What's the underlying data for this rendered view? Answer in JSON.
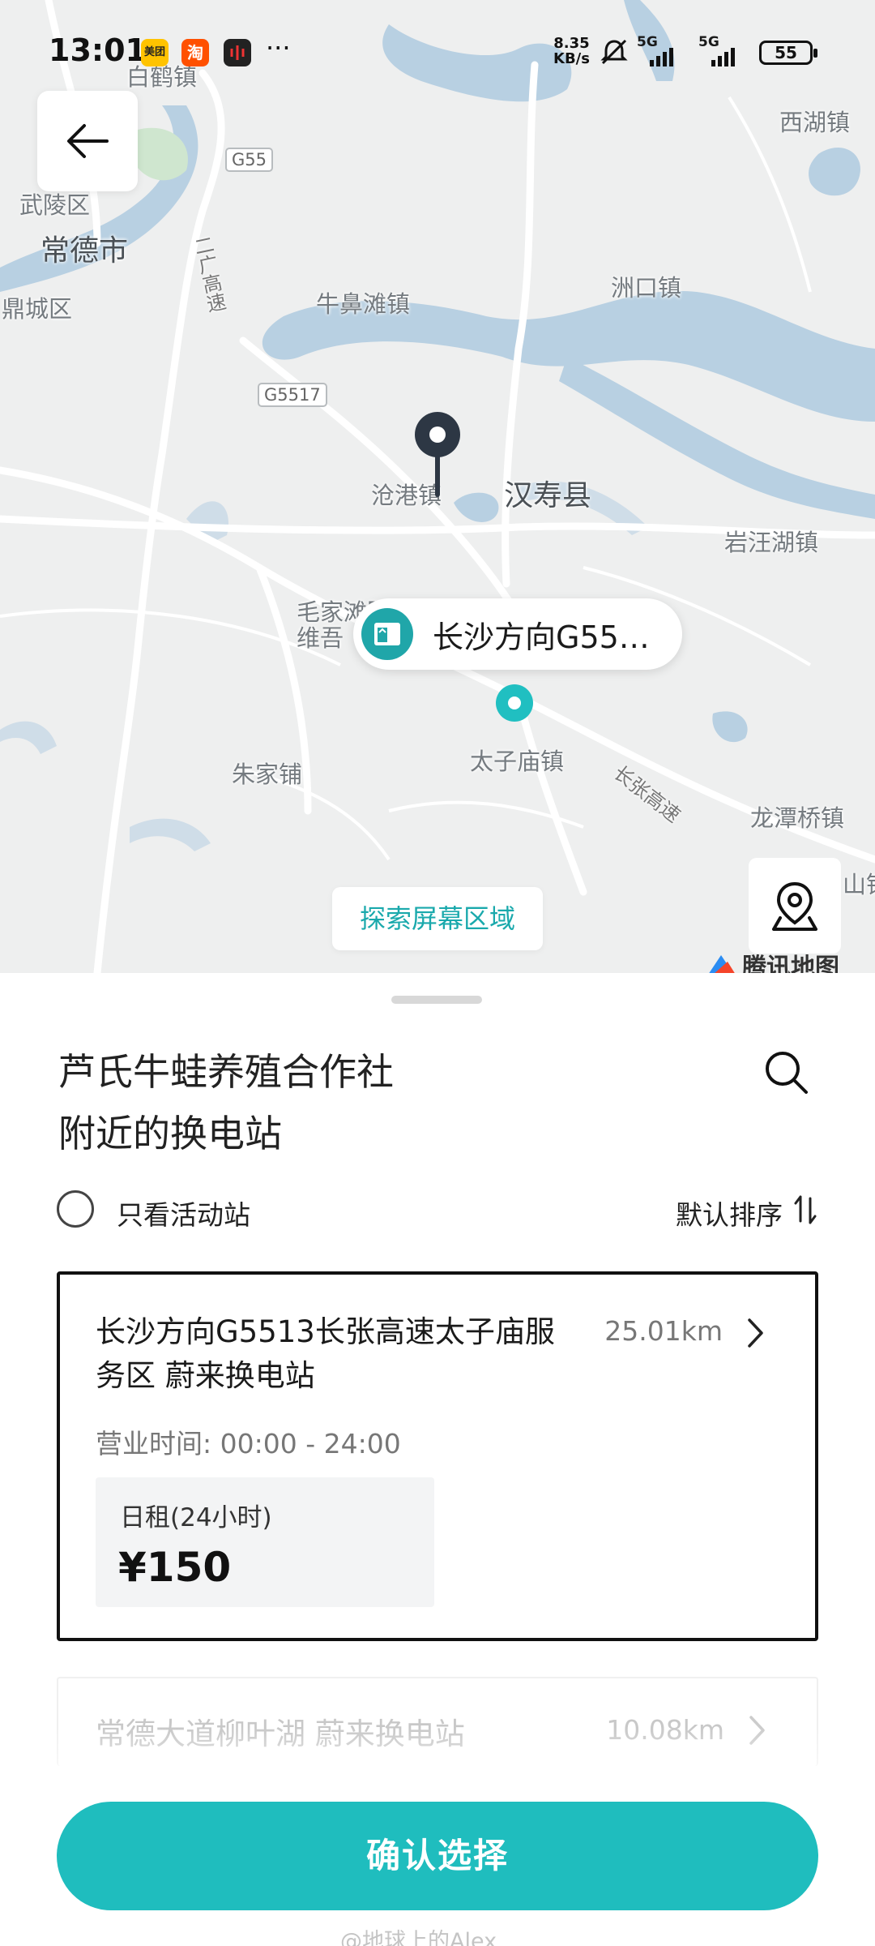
{
  "status_bar": {
    "time": "13:01",
    "app_icons": [
      {
        "name": "meituan-app-icon",
        "label": "美团",
        "color": "#ffc300"
      },
      {
        "name": "taobao-app-icon",
        "label": "淘",
        "color": "#ff5000"
      },
      {
        "name": "voice-app-icon",
        "label": "",
        "color": "#222222"
      }
    ],
    "more": "···",
    "net_speed_value": "8.35",
    "net_speed_unit": "KB/s",
    "signal_1_label": "5G",
    "signal_2_label": "5G",
    "battery": "55"
  },
  "map": {
    "places": {
      "baihe": "白鹤镇",
      "wuling": "武陵区",
      "changde": "常德市",
      "dingcheng": "鼎城区",
      "xihu": "西湖镇",
      "niubitan": "牛鼻滩镇",
      "zhoukou": "洲口镇",
      "canggang": "沧港镇",
      "hanshou": "汉寿县",
      "yanwanghu": "岩汪湖镇",
      "maojiatan": "毛家滩回族",
      "weiwu": "维吾",
      "zhujiapu": "朱家铺",
      "taizimiao": "太子庙镇",
      "longtanqiao": "龙潭桥镇",
      "shan_partial": "山镇"
    },
    "roads": {
      "g55": "G55",
      "g5517": "G5517",
      "erguang": "二广高速",
      "changzhang": "长张高速"
    },
    "callout_label": "长沙方向G55…",
    "explore_button": "探索屏幕区域",
    "logo_text": "腾讯地图",
    "colors": {
      "water": "#b8d0e2",
      "land": "#eeefef",
      "road": "#ffffff",
      "accent": "#1fbdbe"
    }
  },
  "sheet": {
    "title_line1": "芦氏牛蛙养殖合作社",
    "title_line2": "附近的换电站",
    "filter_label": "只看活动站",
    "sort_label": "默认排序",
    "stations": [
      {
        "name": "长沙方向G5513长张高速太子庙服务区 蔚来换电站",
        "distance": "25.01km",
        "hours": "营业时间: 00:00 - 24:00",
        "price_label": "日租(24小时)",
        "price": "¥150"
      },
      {
        "name": "常德大道柳叶湖 蔚来换电站",
        "distance": "10.08km"
      }
    ],
    "confirm_button": "确认选择",
    "watermark": "@地球上的Alex"
  }
}
